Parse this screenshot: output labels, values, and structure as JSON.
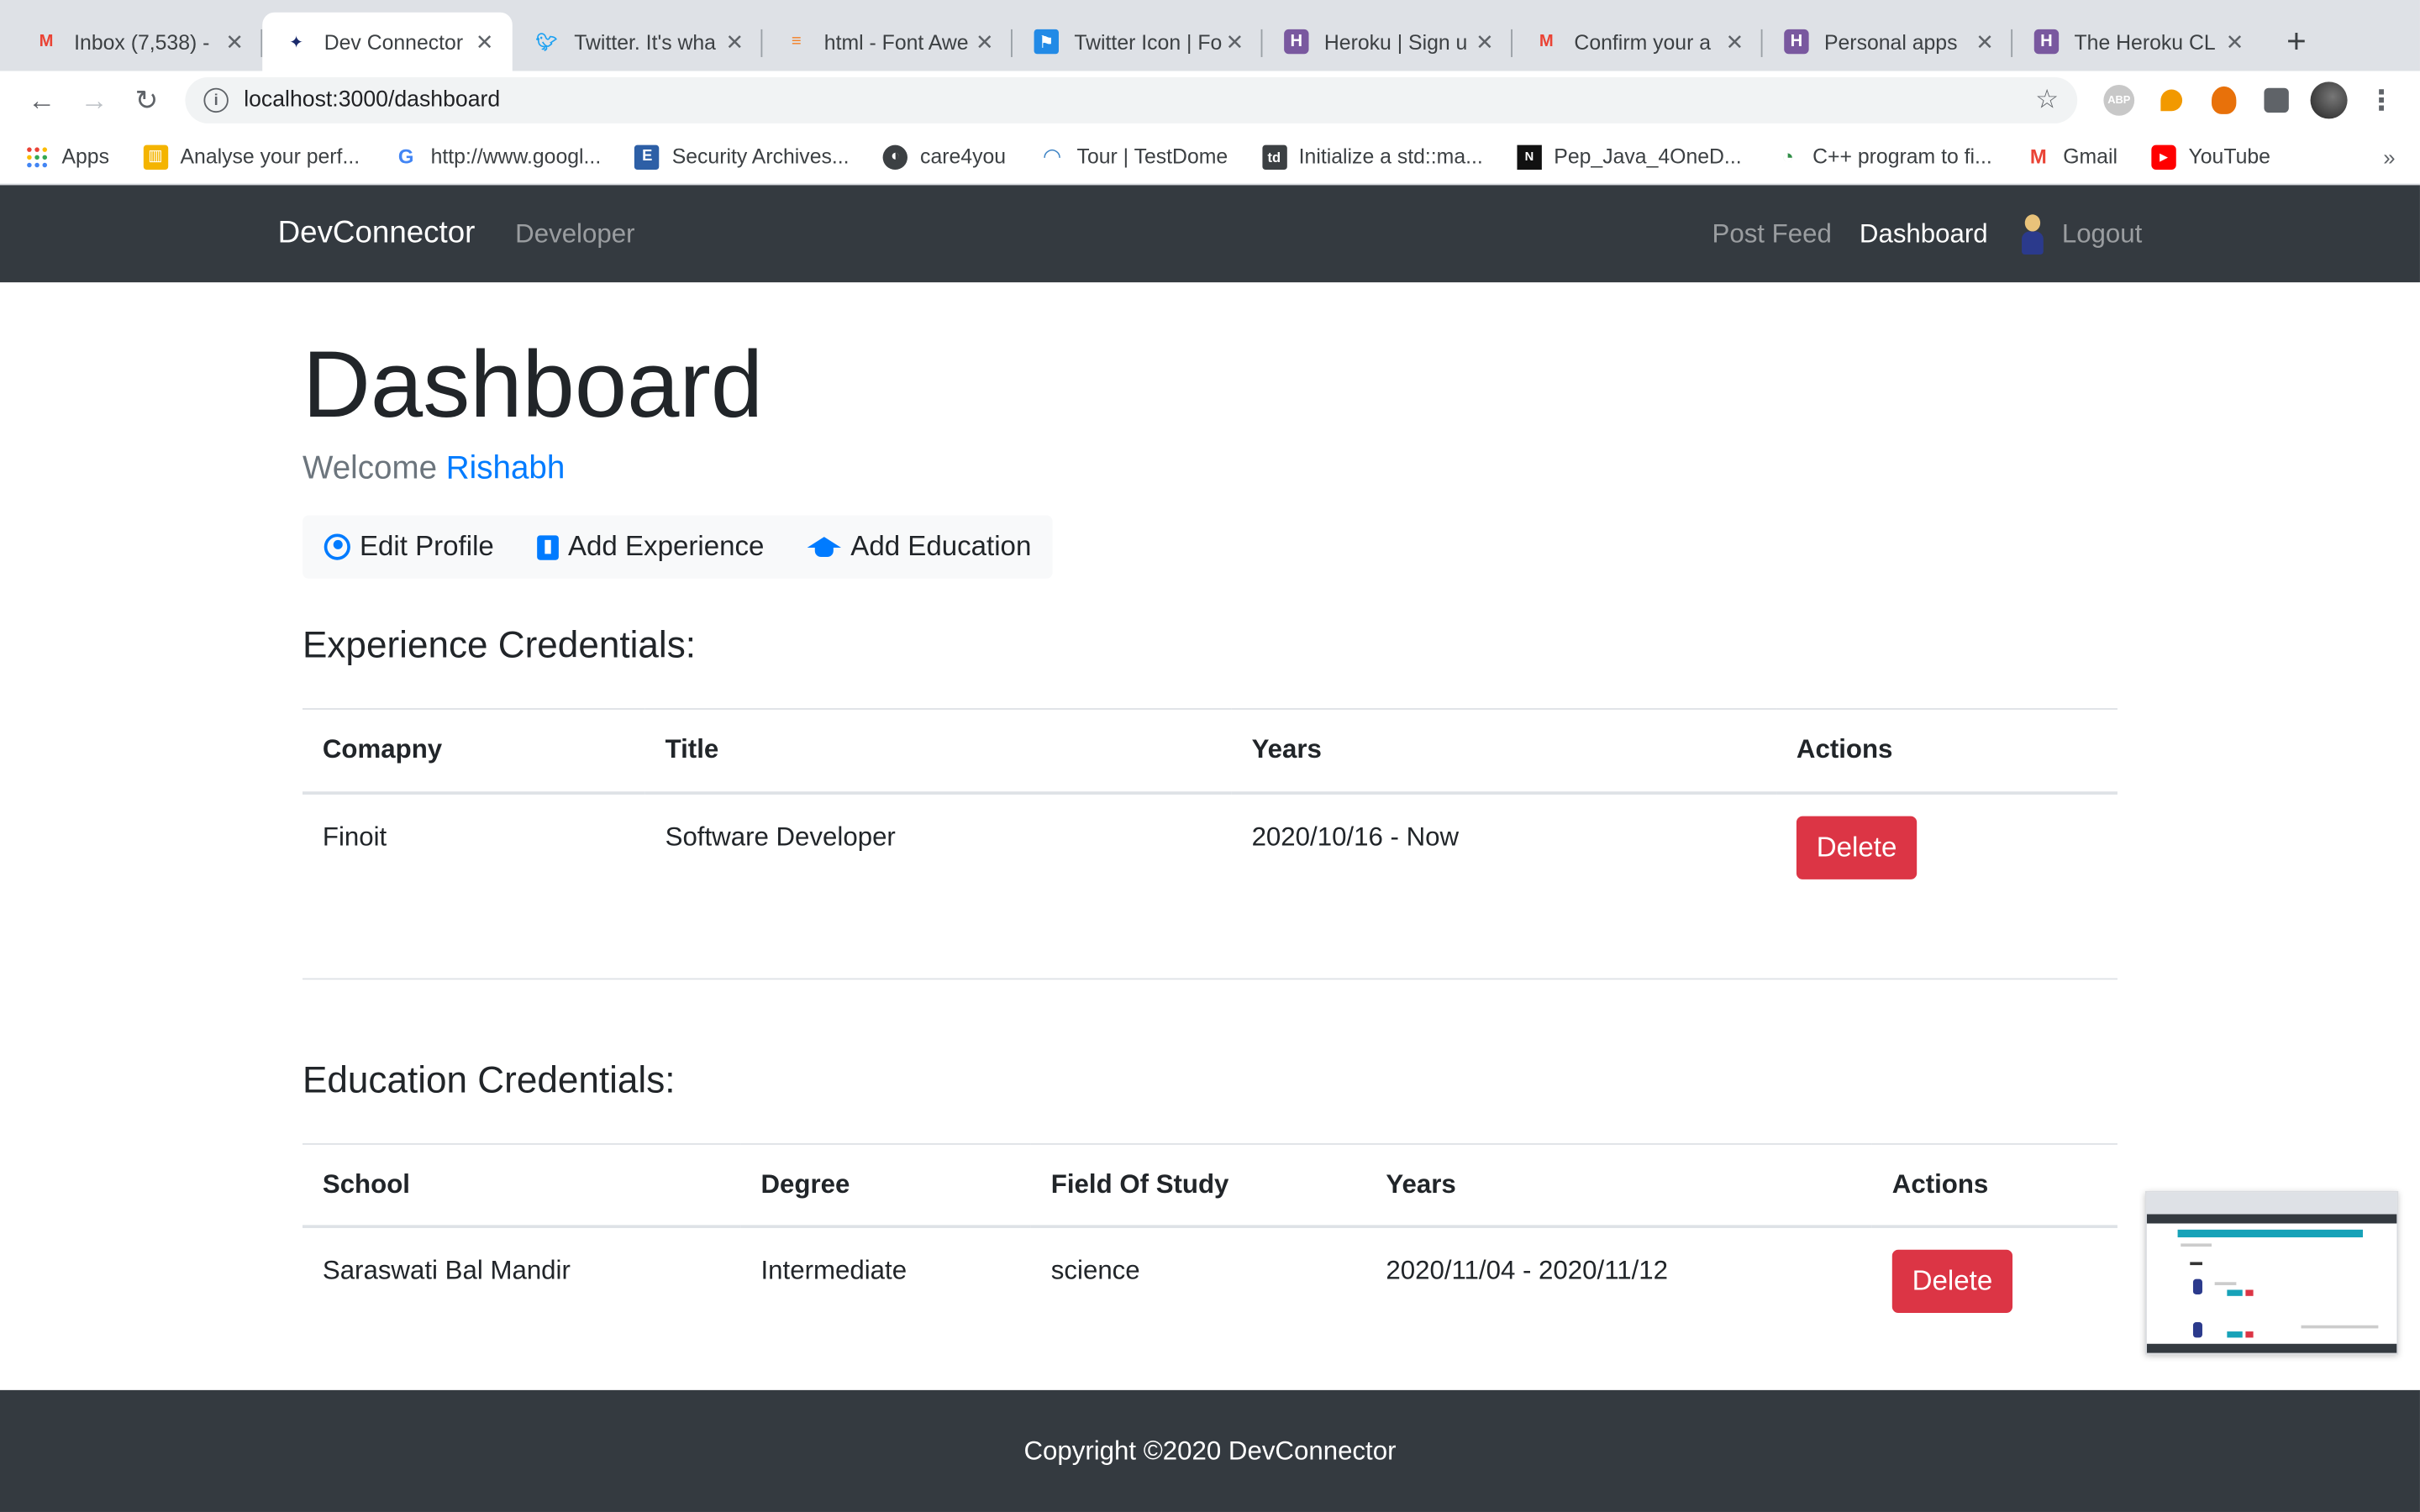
{
  "browser": {
    "tabs": [
      {
        "title": "Inbox (7,538) -",
        "icon": "gmail-icon",
        "color": "#ea4335",
        "active": false
      },
      {
        "title": "Dev Connector",
        "icon": "devconnector-icon",
        "color": "#1a2a6c",
        "active": true
      },
      {
        "title": "Twitter. It's wha",
        "icon": "twitter-icon",
        "color": "#1da1f2",
        "active": false
      },
      {
        "title": "html - Font Awe",
        "icon": "stackoverflow-icon",
        "color": "#f48024",
        "active": false
      },
      {
        "title": "Twitter Icon | Fo",
        "icon": "fontawesome-flag-icon",
        "color": "#228ae6",
        "active": false
      },
      {
        "title": "Heroku | Sign u",
        "icon": "heroku-icon",
        "color": "#79589f",
        "active": false
      },
      {
        "title": "Confirm your a",
        "icon": "gmail-icon",
        "color": "#ea4335",
        "active": false
      },
      {
        "title": "Personal apps",
        "icon": "heroku-icon",
        "color": "#79589f",
        "active": false
      },
      {
        "title": "The Heroku CL",
        "icon": "heroku-icon",
        "color": "#79589f",
        "active": false
      }
    ],
    "close_glyph": "✕",
    "new_tab_glyph": "+",
    "url": "localhost:3000/dashboard",
    "info_glyph": "i",
    "star_glyph": "☆",
    "abp_label": "ABP",
    "menu_glyph": "⋮",
    "bookmarks": [
      {
        "label": "Apps",
        "icon": "apps-grid-icon"
      },
      {
        "label": "Analyse your perf...",
        "icon": "analytics-icon"
      },
      {
        "label": "http://www.googl...",
        "icon": "google-icon"
      },
      {
        "label": "Security Archives...",
        "icon": "security-icon"
      },
      {
        "label": "care4you",
        "icon": "globe-icon"
      },
      {
        "label": "Tour | TestDome",
        "icon": "testdome-icon"
      },
      {
        "label": "Initialize a std::ma...",
        "icon": "td-icon"
      },
      {
        "label": "Pep_Java_4OneD...",
        "icon": "nados-icon"
      },
      {
        "label": "C++ program to fi...",
        "icon": "geeks-icon"
      },
      {
        "label": "Gmail",
        "icon": "gmail-icon"
      },
      {
        "label": "YouTube",
        "icon": "youtube-icon"
      }
    ],
    "bookmarks_more": "»"
  },
  "navbar": {
    "brand": "DevConnector",
    "developer_link": "Developer",
    "post_feed": "Post Feed",
    "dashboard": "Dashboard",
    "logout": "Logout"
  },
  "page": {
    "title": "Dashboard",
    "welcome_prefix": "Welcome ",
    "username": "Rishabh",
    "actions": {
      "edit_profile": "Edit Profile",
      "add_experience": "Add Experience",
      "add_education": "Add Education"
    },
    "experience": {
      "heading": "Experience Credentials:",
      "columns": [
        "Comapny",
        "Title",
        "Years",
        "Actions"
      ],
      "rows": [
        {
          "company": "Finoit",
          "title": "Software Developer",
          "years": "2020/10/16 - Now",
          "action": "Delete"
        }
      ]
    },
    "education": {
      "heading": "Education Credentials:",
      "columns": [
        "School",
        "Degree",
        "Field Of Study",
        "Years",
        "Actions"
      ],
      "rows": [
        {
          "school": "Saraswati Bal Mandir",
          "degree": "Intermediate",
          "field": "science",
          "years": "2020/11/04 - 2020/11/12",
          "action": "Delete"
        }
      ]
    }
  },
  "footer": {
    "text": "Copyright ©2020 DevConnector"
  },
  "colors": {
    "navbar_bg": "#343a40",
    "primary": "#007bff",
    "danger": "#dc3545"
  }
}
